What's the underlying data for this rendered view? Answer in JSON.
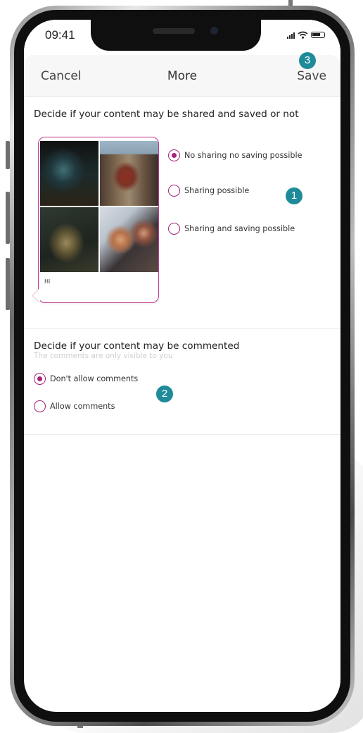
{
  "status_bar": {
    "time": "09:41"
  },
  "nav": {
    "cancel": "Cancel",
    "title": "More",
    "save": "Save"
  },
  "badges": {
    "one": "1",
    "two": "2",
    "three": "3"
  },
  "sharing": {
    "heading": "Decide if your content may be shared and saved or not",
    "caption": "Hi",
    "options": [
      {
        "label": "No sharing no saving possible",
        "checked": true
      },
      {
        "label": "Sharing possible",
        "checked": false
      },
      {
        "label": "Sharing and saving possible",
        "checked": false
      }
    ]
  },
  "comments": {
    "heading": "Decide if your content may be commented",
    "subheading": "The comments are only visible to you",
    "options": [
      {
        "label": "Don't allow comments",
        "checked": true
      },
      {
        "label": "Allow comments",
        "checked": false
      }
    ]
  },
  "colors": {
    "accent": "#a5237a",
    "badge": "#1f8b9a"
  }
}
